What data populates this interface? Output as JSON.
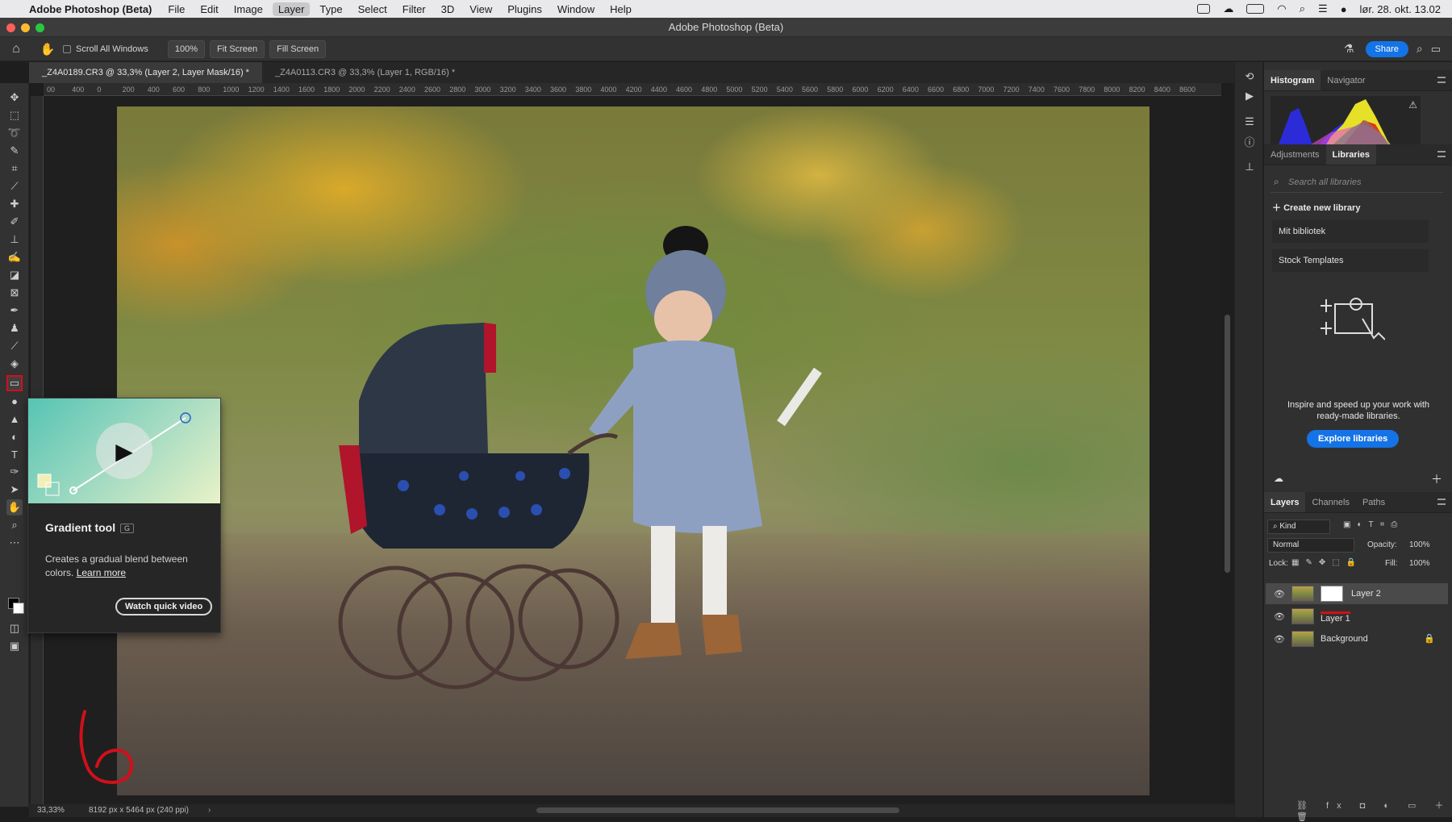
{
  "menubar": {
    "app_name": "Adobe Photoshop (Beta)",
    "items": [
      "File",
      "Edit",
      "Image",
      "Layer",
      "Type",
      "Select",
      "Filter",
      "3D",
      "View",
      "Plugins",
      "Window",
      "Help"
    ],
    "clock": "lør. 28. okt. 13.02"
  },
  "window": {
    "title": "Adobe Photoshop (Beta)"
  },
  "options_bar": {
    "scroll_all_label": "Scroll All Windows",
    "zoom_value": "100%",
    "fit_screen_label": "Fit Screen",
    "fill_screen_label": "Fill Screen",
    "share_label": "Share"
  },
  "tabs": [
    {
      "label": "_Z4A0189.CR3 @ 33,3% (Layer 2, Layer Mask/16) *"
    },
    {
      "label": "_Z4A0113.CR3 @ 33,3% (Layer 1, RGB/16) *"
    }
  ],
  "ruler_ticks": [
    "00",
    "400",
    "0",
    "200",
    "400",
    "600",
    "800",
    "1000",
    "1200",
    "1400",
    "1600",
    "1800",
    "2000",
    "2200",
    "2400",
    "2600",
    "2800",
    "3000",
    "3200",
    "3400",
    "3600",
    "3800",
    "4000",
    "4200",
    "4400",
    "4600",
    "4800",
    "5000",
    "5200",
    "5400",
    "5600",
    "5800",
    "6000",
    "6200",
    "6400",
    "6600",
    "6800",
    "7000",
    "7200",
    "7400",
    "7600",
    "7800",
    "8000",
    "8200",
    "8400",
    "8600"
  ],
  "tooltip": {
    "title": "Gradient tool",
    "shortcut": "G",
    "description": "Creates a gradual blend between colors.",
    "learn_more": "Learn more",
    "video_button": "Watch quick video"
  },
  "top_panel": {
    "tabs": [
      "Histogram",
      "Navigator"
    ]
  },
  "libraries_panel": {
    "tabs": [
      "Adjustments",
      "Libraries"
    ],
    "search_placeholder": "Search all libraries",
    "create_label": "Create new library",
    "libraries": [
      "Mit bibliotek",
      "Stock Templates"
    ],
    "promo_text": "Inspire and speed up your work with ready-made libraries.",
    "explore_label": "Explore libraries"
  },
  "layers_panel": {
    "tabs": [
      "Layers",
      "Channels",
      "Paths"
    ],
    "filter_kind": "Kind",
    "blend_mode": "Normal",
    "opacity_label": "Opacity:",
    "opacity_value": "100%",
    "lock_label": "Lock:",
    "fill_label": "Fill:",
    "fill_value": "100%",
    "layers": [
      {
        "name": "Layer 2"
      },
      {
        "name": "Layer 1"
      },
      {
        "name": "Background"
      }
    ]
  },
  "status": {
    "zoom": "33,33%",
    "doc_size": "8192 px x 5464 px (240 ppi)"
  },
  "colors": {
    "accent": "#1473e6",
    "annotation_red": "#d0101a"
  }
}
